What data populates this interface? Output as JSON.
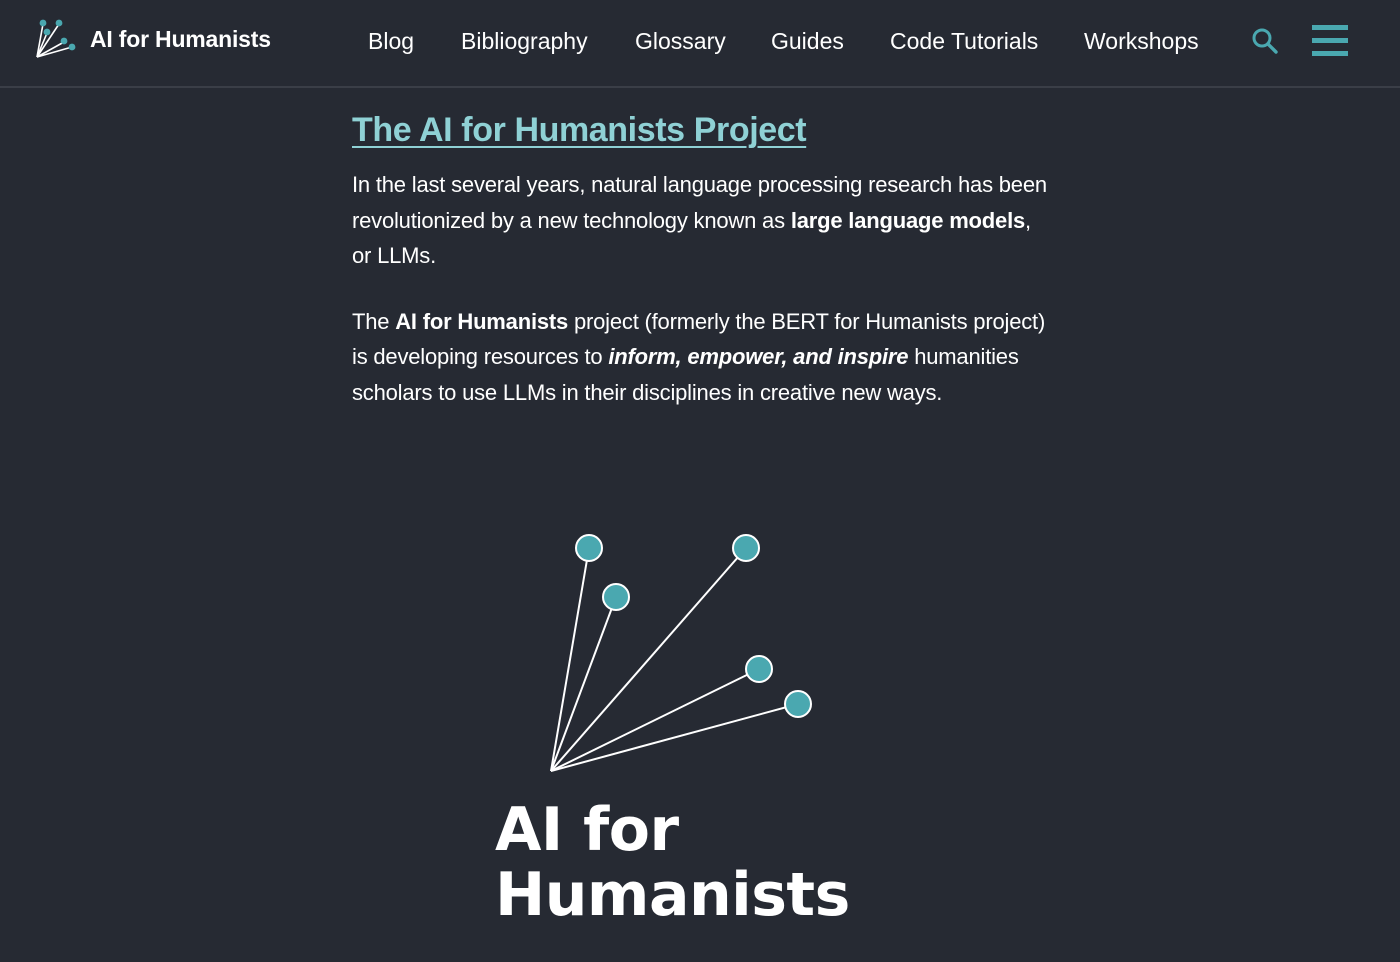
{
  "site": {
    "brand": "AI for Humanists"
  },
  "nav": {
    "items": [
      {
        "label": "Blog"
      },
      {
        "label": "Bibliography"
      },
      {
        "label": "Glossary"
      },
      {
        "label": "Guides"
      },
      {
        "label": "Code Tutorials"
      },
      {
        "label": "Workshops"
      }
    ],
    "search_icon": "search-icon",
    "menu_icon": "hamburger-menu-icon"
  },
  "colors": {
    "background": "#262a33",
    "accent": "#4aa8b0",
    "title_link": "#8fd1d5",
    "text": "#ffffff"
  },
  "main": {
    "title": "The AI for Humanists Project",
    "p1": {
      "t1": "In the last several years, natural language processing research has been revolutionized by a new technology known as ",
      "bold": "large language models",
      "t2": ", or LLMs."
    },
    "p2": {
      "t1": "The ",
      "bold": "AI for Humanists",
      "t2": " project (formerly the BERT for Humanists project) is developing resources to ",
      "bold_italic": "inform, empower, and inspire",
      "t3": " humanities scholars to use LLMs in their disciplines in creative new ways."
    }
  },
  "hero": {
    "title_line1": "AI for",
    "title_line2": "Humanists"
  }
}
